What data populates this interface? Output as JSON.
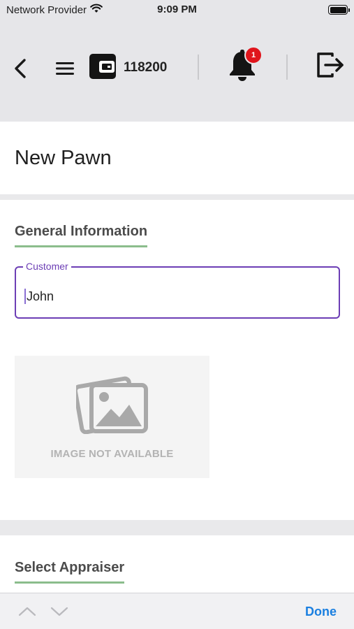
{
  "status_bar": {
    "carrier": "Network Provider",
    "time": "9:09 PM",
    "wifi_icon": "wifi-icon",
    "battery_icon": "battery-icon"
  },
  "header": {
    "back_icon": "chevron-left-icon",
    "menu_icon": "hamburger-menu-icon",
    "wallet_icon": "wallet-icon",
    "balance": "118200",
    "notification_icon": "bell-icon",
    "notification_count": "1",
    "notification_badge_color": "#e0151c",
    "logout_icon": "logout-icon"
  },
  "page": {
    "title": "New Pawn"
  },
  "general_information": {
    "heading": "General Information",
    "heading_underline_color": "#8bbd8c",
    "customer_field": {
      "label": "Customer",
      "value": "John",
      "focus_color": "#6c3eb5"
    },
    "image_placeholder": {
      "icon": "image-placeholder-icon",
      "text": "IMAGE NOT AVAILABLE"
    }
  },
  "select_appraiser": {
    "heading": "Select Appraiser"
  },
  "keyboard_accessory": {
    "prev_icon": "chevron-up-icon",
    "next_icon": "chevron-down-icon",
    "done_label": "Done",
    "done_color": "#1a7fe0"
  }
}
